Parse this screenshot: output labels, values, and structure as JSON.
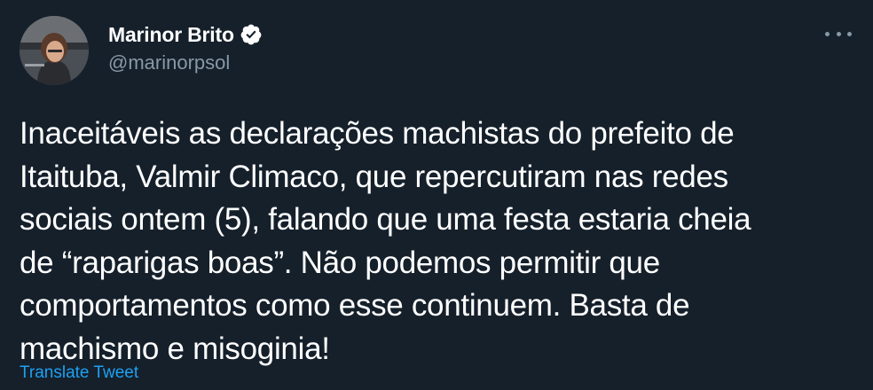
{
  "tweet": {
    "author": {
      "display_name": "Marinor Brito",
      "handle": "@marinorpsol",
      "verified": true,
      "avatar_icon": "user-avatar-photo"
    },
    "more_icon": "more-options-icon",
    "text": "Inaceitáveis as declarações machistas do prefeito de\nItaituba, Valmir Climaco, que repercutiram nas redes\nsociais ontem (5), falando que uma festa estaria cheia\nde “raparigas boas”. Não podemos permitir que\ncomportamentos como esse continuem. Basta de\nmachismo e misoginia!",
    "translate_label": "Translate Tweet"
  },
  "colors": {
    "background": "#15202b",
    "text_primary": "#ffffff",
    "text_secondary": "#8899a6",
    "accent": "#1da1f2"
  }
}
